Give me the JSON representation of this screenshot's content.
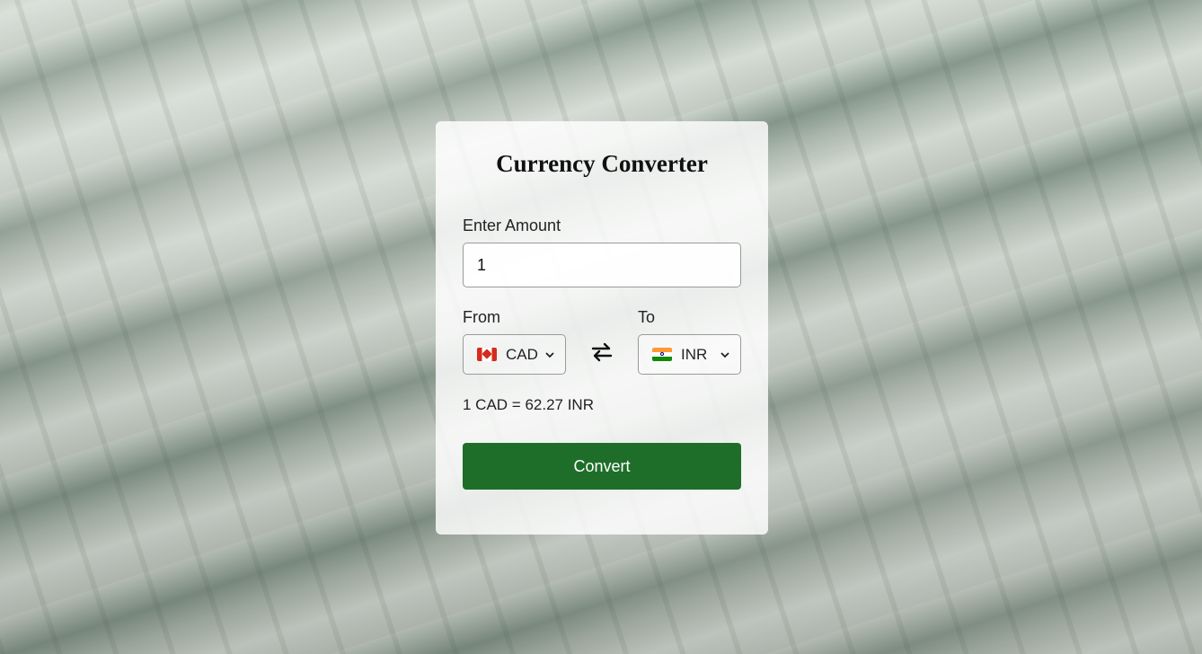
{
  "app": {
    "title": "Currency Converter"
  },
  "amount": {
    "label": "Enter Amount",
    "value": "1"
  },
  "from": {
    "label": "From",
    "code": "CAD",
    "flag_icon": "canada-flag-icon"
  },
  "to": {
    "label": "To",
    "code": "INR",
    "flag_icon": "india-flag-icon"
  },
  "rate_text": "1 CAD = 62.27 INR",
  "convert_label": "Convert",
  "colors": {
    "button": "#1e6e2a",
    "card": "#ffffffd1"
  }
}
